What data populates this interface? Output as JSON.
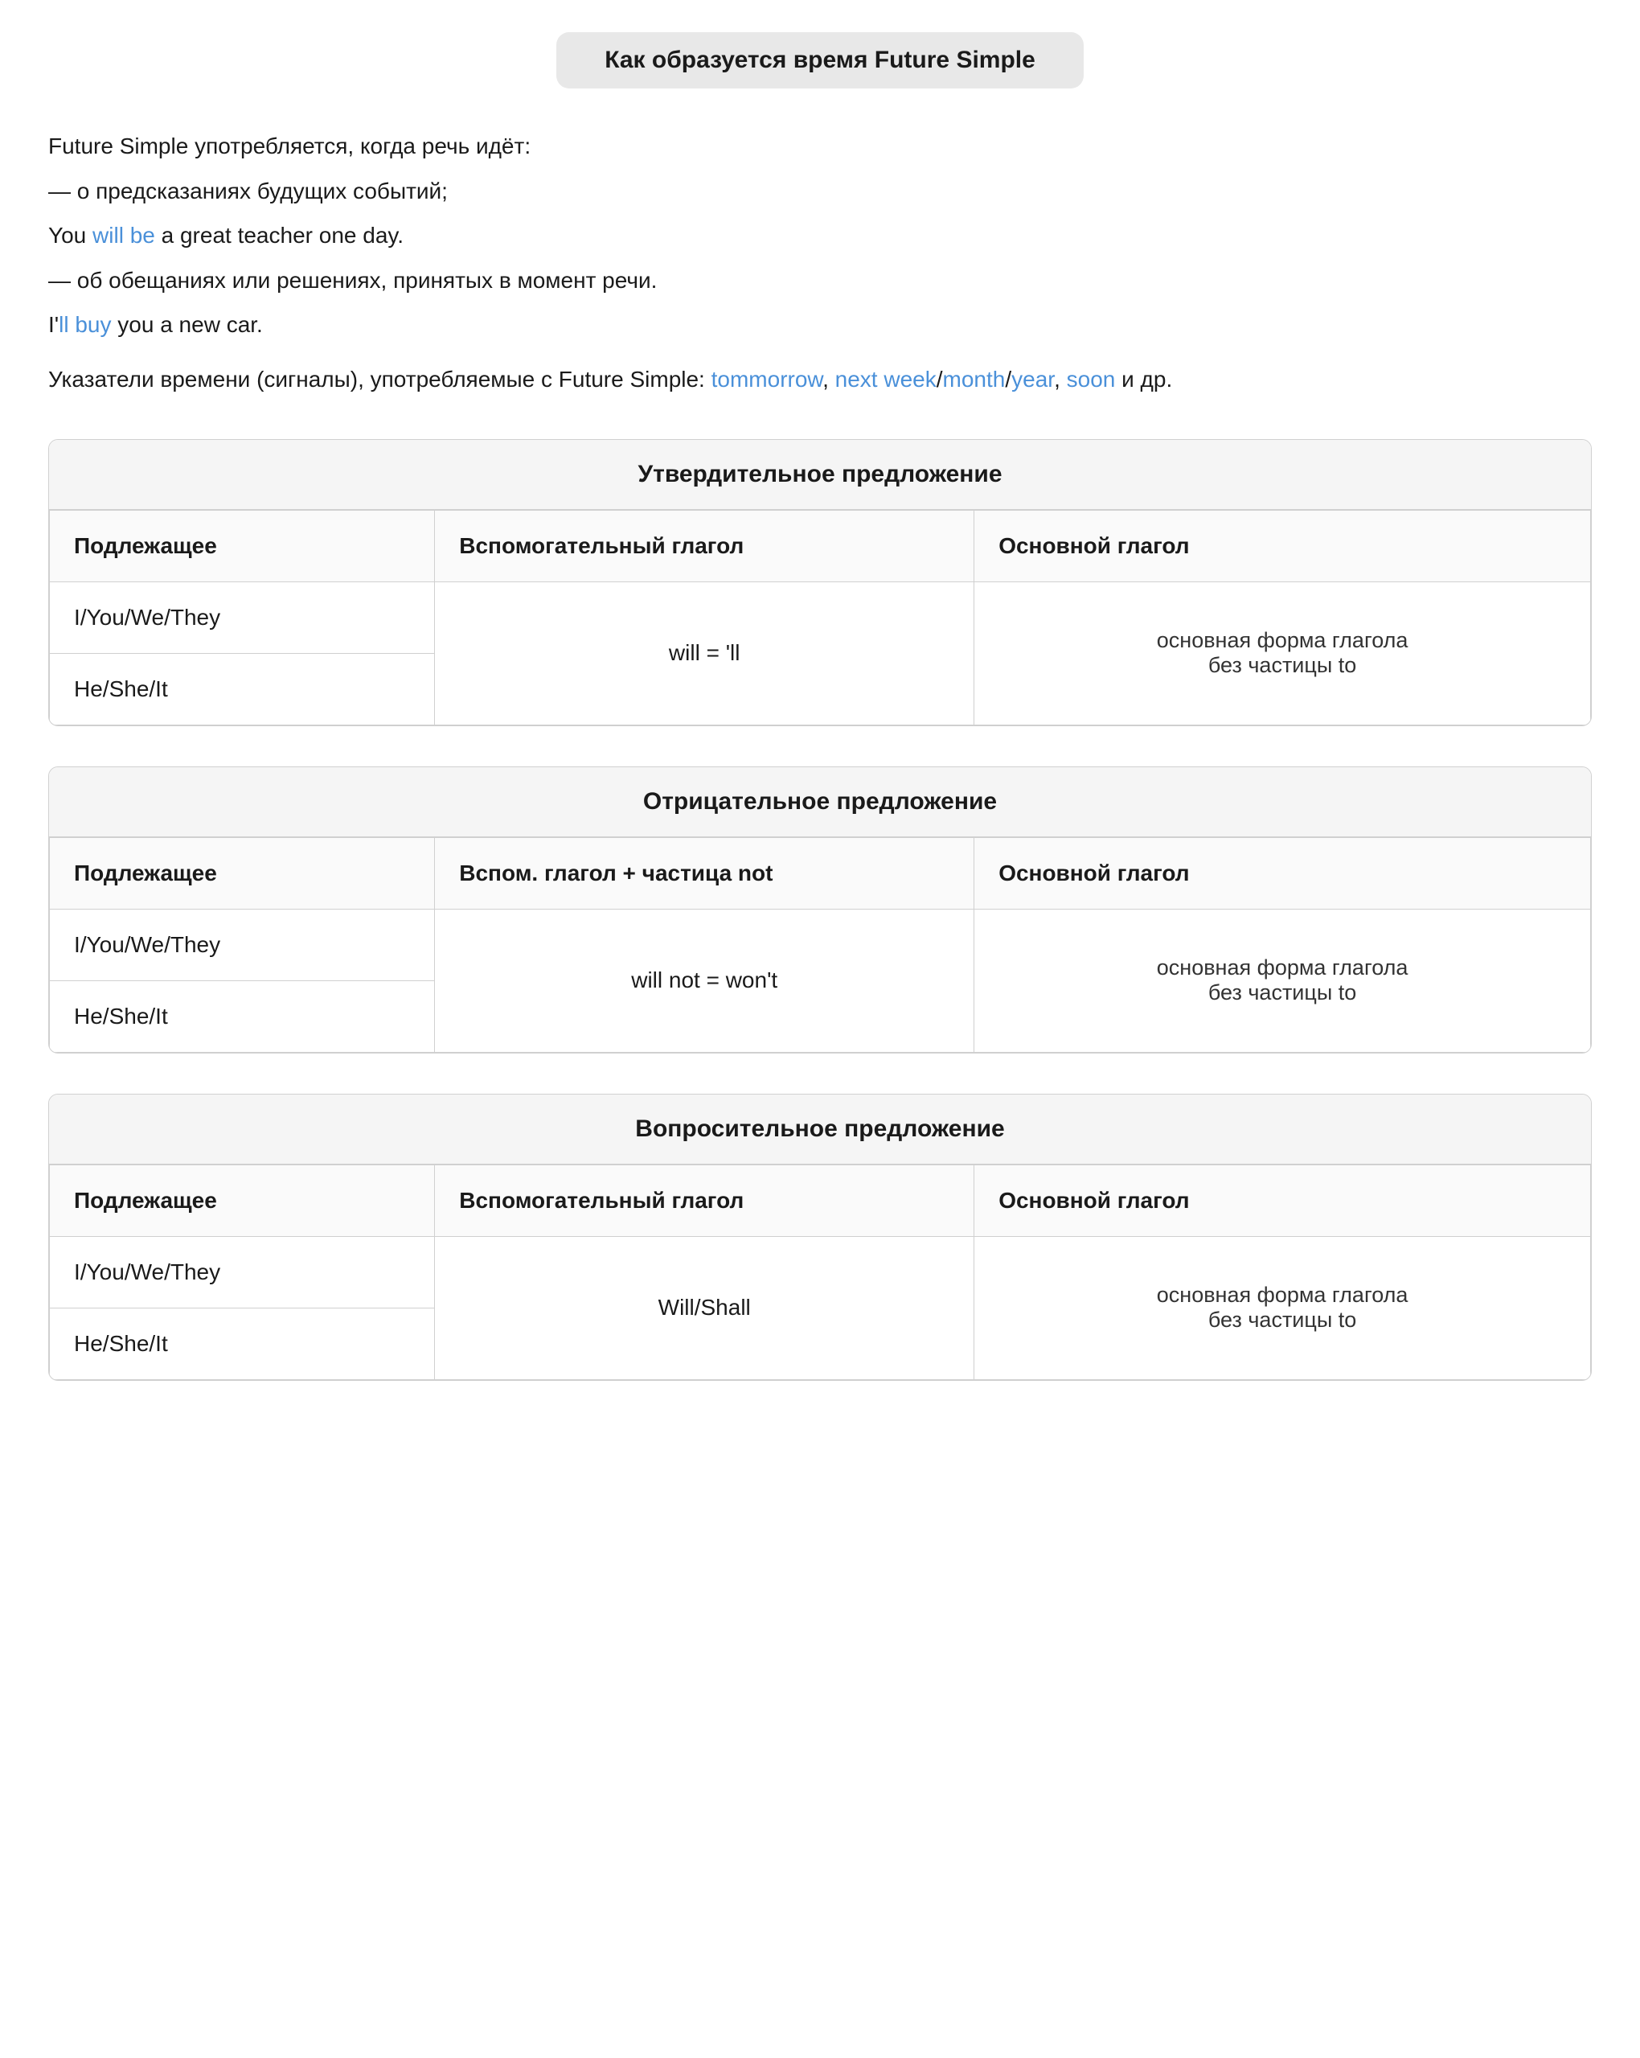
{
  "page": {
    "title": "Как образуется время Future Simple",
    "intro": {
      "line1": "Future Simple употребляется, когда речь идёт:",
      "line2": "— о предсказаниях будущих событий;",
      "line3_pre": "You ",
      "line3_blue": "will be",
      "line3_post": " a great teacher one day.",
      "line4": "— об обещаниях или решениях, принятых в момент речи.",
      "line5_pre": "I'",
      "line5_blue": "ll buy",
      "line5_post": " you a new car.",
      "line6_pre": "Указатели времени (сигналы), употребляемые с Future Simple: ",
      "line6_blue1": "tommorrow",
      "line6_comma": ", ",
      "line6_blue2": "next week",
      "line6_slash1": "/",
      "line6_blue3": "month",
      "line6_slash2": "/",
      "line6_blue4": "year",
      "line6_comma2": ", ",
      "line6_blue5": "soon",
      "line6_end": " и др."
    },
    "sections": [
      {
        "id": "affirmative",
        "header": "Утвердительное предложение",
        "col1": "Подлежащее",
        "col2": "Вспомогательный глагол",
        "col3": "Основной глагол",
        "subject_top": "I/You/We/They",
        "subject_bottom": "He/She/It",
        "aux_verb": "will = 'll",
        "main_verb_line1": "основная форма глагола",
        "main_verb_line2": "без частицы to"
      },
      {
        "id": "negative",
        "header": "Отрицательное предложение",
        "col1": "Подлежащее",
        "col2": "Вспом. глагол + частица not",
        "col3": "Основной глагол",
        "subject_top": "I/You/We/They",
        "subject_bottom": "He/She/It",
        "aux_verb": "will not = won't",
        "main_verb_line1": "основная форма глагола",
        "main_verb_line2": "без частицы to"
      },
      {
        "id": "interrogative",
        "header": "Вопросительное предложение",
        "col1": "Подлежащее",
        "col2": "Вспомогательный глагол",
        "col3": "Основной глагол",
        "subject_top": "I/You/We/They",
        "subject_bottom": "He/She/It",
        "aux_verb": "Will/Shall",
        "main_verb_line1": "основная форма глагола",
        "main_verb_line2": "без частицы to"
      }
    ]
  }
}
